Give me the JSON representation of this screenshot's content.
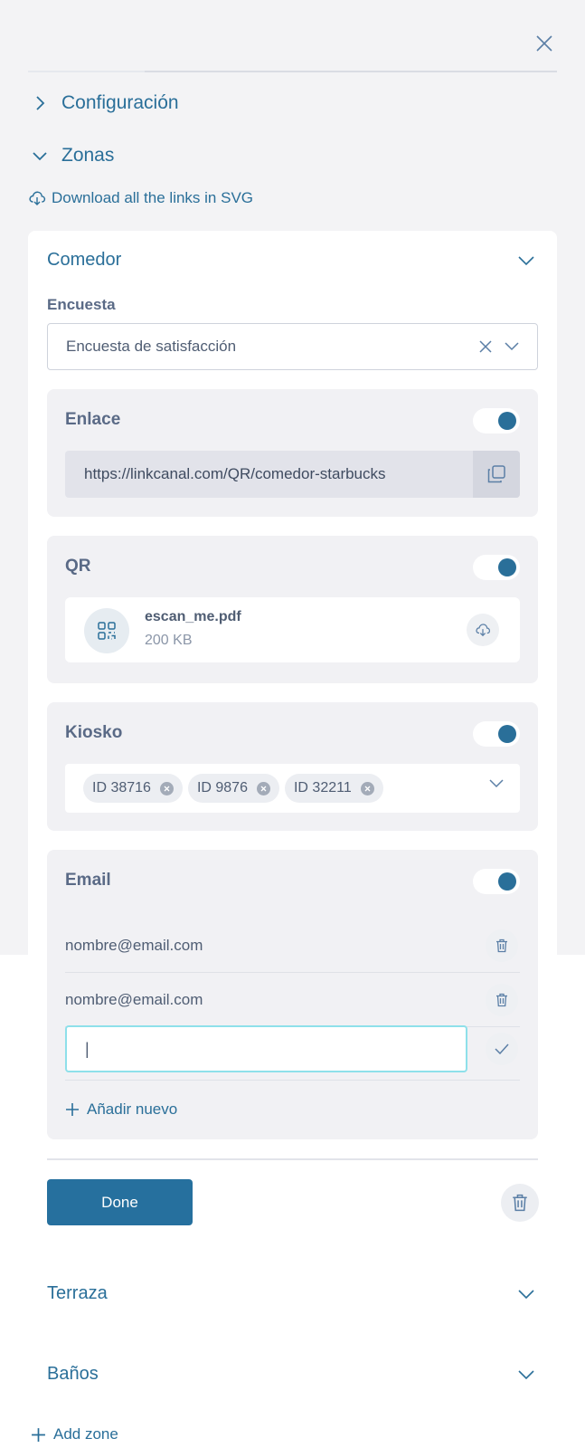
{
  "header": {
    "close_icon": "close-icon"
  },
  "progress": {
    "fraction": 0.22
  },
  "sections": {
    "configuracion": {
      "label": "Configuración",
      "expanded": false
    },
    "zonas": {
      "label": "Zonas",
      "expanded": true
    }
  },
  "download_all": {
    "label": "Download all the links in SVG",
    "icon": "cloud-download-icon"
  },
  "zone": {
    "title": "Comedor",
    "encuesta_label": "Encuesta",
    "encuesta_value": "Encuesta de satisfacción",
    "enlace": {
      "title": "Enlace",
      "enabled": true,
      "url": "https://linkcanal.com/QR/comedor-starbucks"
    },
    "qr": {
      "title": "QR",
      "enabled": true,
      "file_name": "escan_me.pdf",
      "file_size": "200 KB"
    },
    "kiosko": {
      "title": "Kiosko",
      "enabled": true,
      "chips": [
        "ID 38716",
        "ID 9876",
        "ID 32211"
      ]
    },
    "email": {
      "title": "Email",
      "enabled": true,
      "entries": [
        "nombre@email.com",
        "nombre@email.com"
      ],
      "input_value": "|",
      "add_label": "Añadir nuevo"
    },
    "done_label": "Done"
  },
  "other_zones": [
    "Terraza",
    "Baños"
  ],
  "add_zone_label": "Add zone",
  "colors": {
    "accent": "#2a6f99",
    "button": "#26709e",
    "focus": "#8ee0ea",
    "card": "#f1f1f4"
  }
}
